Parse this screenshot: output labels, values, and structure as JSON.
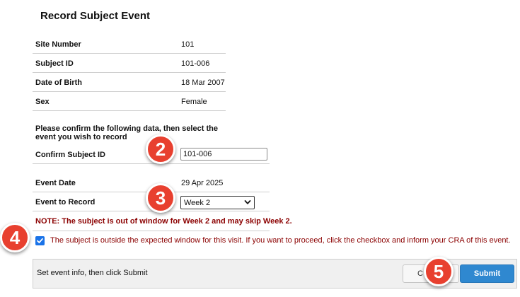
{
  "page": {
    "title": "Record Subject Event"
  },
  "subject_info": [
    {
      "label": "Site Number",
      "value": "101"
    },
    {
      "label": "Subject ID",
      "value": "101-006"
    },
    {
      "label": "Date of Birth",
      "value": "18 Mar 2007"
    },
    {
      "label": "Sex",
      "value": "Female"
    }
  ],
  "instruction": "Please confirm the following data, then select the event you wish to record",
  "confirm_subject": {
    "label": "Confirm Subject ID",
    "value": "101-006"
  },
  "event_date": {
    "label": "Event Date",
    "value": "29 Apr 2025"
  },
  "event_to_record": {
    "label": "Event to Record",
    "selected": "Week 2"
  },
  "note": "NOTE: The subject is out of window for Week 2 and may skip Week 2.",
  "window_checkbox": {
    "checked": true,
    "text": "The subject is outside the expected window for this visit. If you want to proceed, click the checkbox and inform your CRA of this event."
  },
  "footer": {
    "message": "Set event info, then click Submit",
    "cancel_label": "C",
    "submit_label": "Submit"
  },
  "annotations": [
    "2",
    "3",
    "4",
    "5"
  ],
  "colors": {
    "badge": "#e8402f",
    "note_text": "#8b0000",
    "submit_button": "#2f88d0",
    "checkbox": "#1a73e8"
  }
}
